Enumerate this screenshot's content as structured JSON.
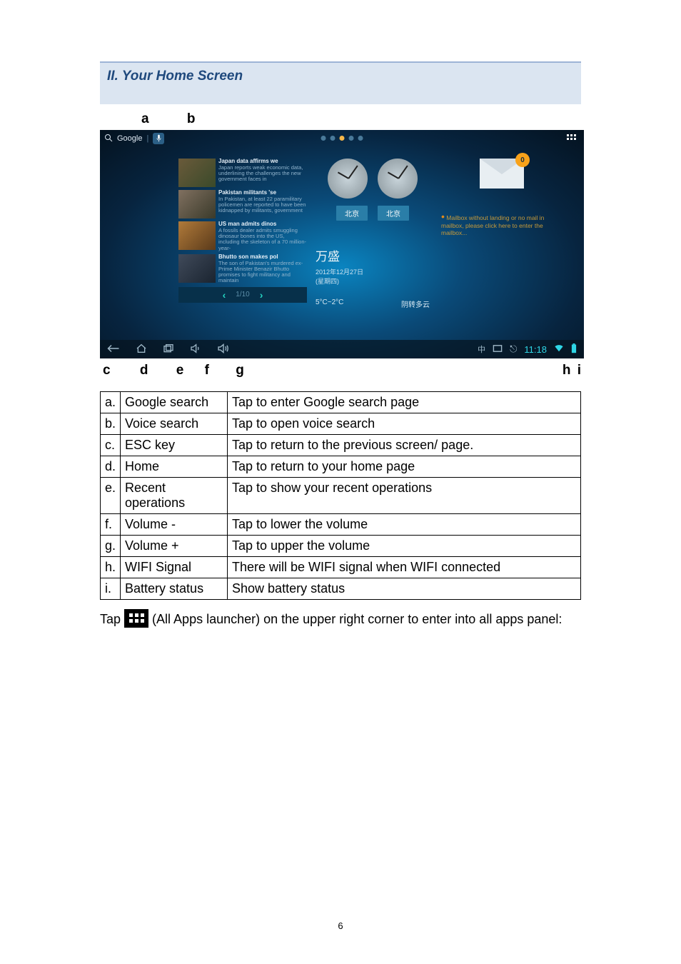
{
  "section_title": "II. Your Home Screen",
  "top_labels": {
    "a": "a",
    "b": "b"
  },
  "screenshot": {
    "search_label": "Google",
    "apps_grid": "⠿",
    "news": [
      {
        "title": "Japan data affirms we",
        "body": "Japan reports weak economic data, underlining the challenges the new government faces in"
      },
      {
        "title": "Pakistan militants 'se",
        "body": "In Pakistan, at least 22 paramilitary policemen are reported to have been kidnapped by militants, government"
      },
      {
        "title": "US man admits dinos",
        "body": "A fossils dealer admits smuggling dinosaur bones into the US, including the skeleton of a 70 million-year-"
      },
      {
        "title": "Bhutto son makes pol",
        "body": "The son of Pakistan's murdered ex-Prime Minister Benazir Bhutto promises to fight militancy and maintain"
      }
    ],
    "pager": "1/10",
    "city1": "北京",
    "city2": "北京",
    "place": "万盛",
    "date": "2012年12月27日",
    "weekday": "(星期四)",
    "temp": "5°C~2°C",
    "cond": "阴转多云",
    "mail_badge": "0",
    "mail_text": "Mailbox without landing or no mail in mailbox, please click here to enter the mailbox...",
    "time": "11:18"
  },
  "bottom_labels": {
    "c": "c",
    "d": "d",
    "e": "e",
    "f": "f",
    "g": "g",
    "h": "h",
    "i": "i"
  },
  "legend": [
    {
      "k": "a.",
      "n": "Google search",
      "d": "Tap to enter Google search page"
    },
    {
      "k": "b.",
      "n": "Voice search",
      "d": "Tap to open voice search"
    },
    {
      "k": "c.",
      "n": "ESC key",
      "d": "Tap to return to the previous screen/ page."
    },
    {
      "k": "d.",
      "n": "Home",
      "d": "Tap to return to your home page"
    },
    {
      "k": "e.",
      "n": "Recent operations",
      "d": "Tap to show your recent operations"
    },
    {
      "k": "f.",
      "n": "Volume -",
      "d": "Tap to lower the volume"
    },
    {
      "k": "g.",
      "n": "Volume +",
      "d": "Tap to upper the volume"
    },
    {
      "k": "h.",
      "n": "WIFI Signal",
      "d": "There will be WIFI signal when WIFI connected"
    },
    {
      "k": "i.",
      "n": "Battery status",
      "d": "Show battery status"
    }
  ],
  "para_before": "Tap ",
  "para_after": " (All Apps launcher) on the upper right corner to enter into all apps panel:",
  "page_number": "6"
}
